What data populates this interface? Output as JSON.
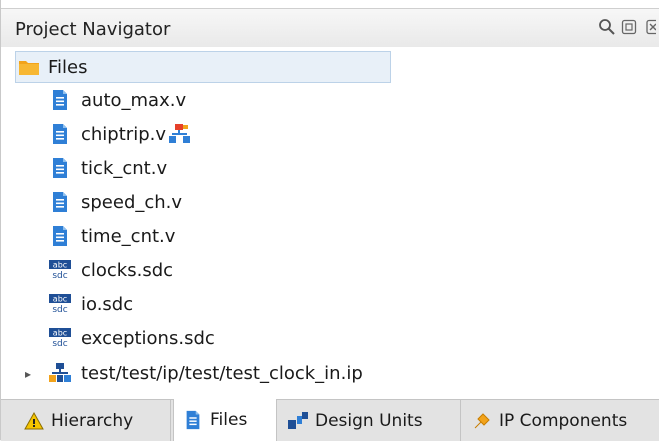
{
  "window": {
    "title": "Project Navigator",
    "icons": [
      "search-icon",
      "restore-icon",
      "close-icon"
    ]
  },
  "tree": {
    "root": {
      "label": "Files",
      "icon": "folder-icon"
    },
    "items": [
      {
        "label": "auto_max.v",
        "icon": "verilog-file-icon"
      },
      {
        "label": "chiptrip.v",
        "icon": "verilog-file-icon",
        "badge": "top-level-entity-icon"
      },
      {
        "label": "tick_cnt.v",
        "icon": "verilog-file-icon"
      },
      {
        "label": "speed_ch.v",
        "icon": "verilog-file-icon"
      },
      {
        "label": "time_cnt.v",
        "icon": "verilog-file-icon"
      },
      {
        "label": "clocks.sdc",
        "icon": "sdc-file-icon"
      },
      {
        "label": "io.sdc",
        "icon": "sdc-file-icon"
      },
      {
        "label": "exceptions.sdc",
        "icon": "sdc-file-icon"
      },
      {
        "label": "test/test/ip/test/test_clock_in.ip",
        "icon": "ip-file-icon",
        "expandable": true
      }
    ]
  },
  "tabs": [
    {
      "label": "Hierarchy",
      "icon": "hierarchy-icon",
      "active": false
    },
    {
      "label": "Files",
      "icon": "files-icon",
      "active": true
    },
    {
      "label": "Design Units",
      "icon": "design-units-icon",
      "active": false
    },
    {
      "label": "IP Components",
      "icon": "ip-components-icon",
      "active": false
    }
  ],
  "colors": {
    "file_blue": "#2f7fd6",
    "folder_orange": "#f2a31b",
    "selection": "#e8f0f8"
  }
}
